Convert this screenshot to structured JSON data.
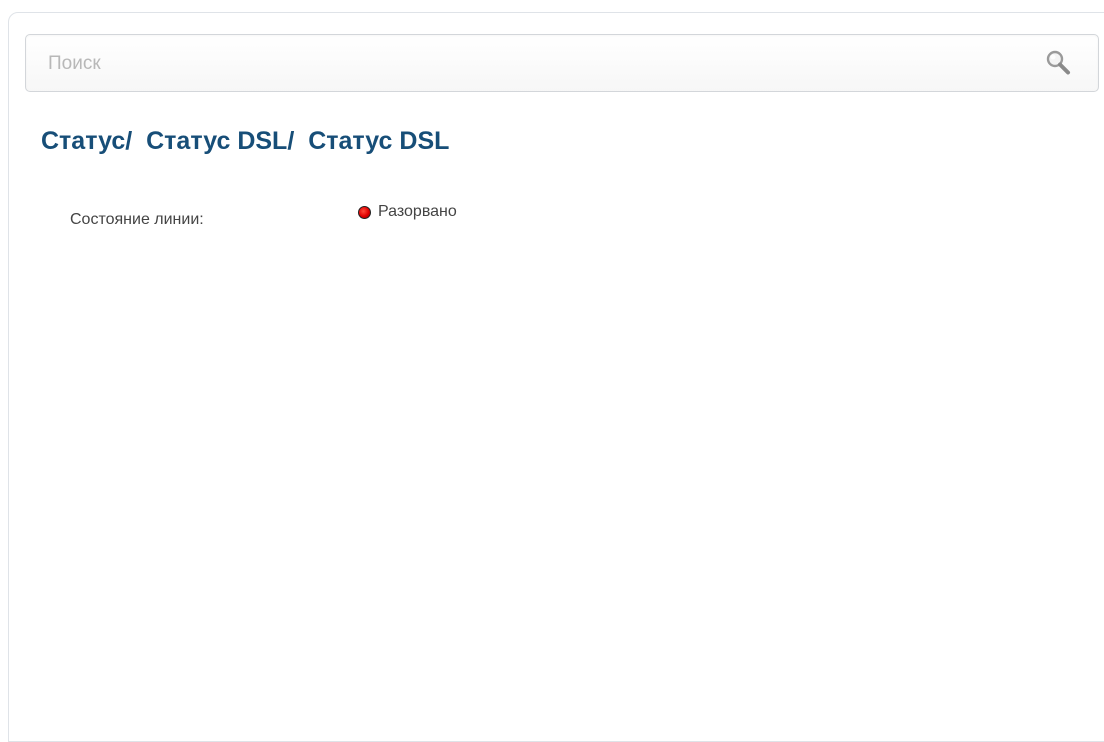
{
  "search": {
    "placeholder": "Поиск",
    "value": "",
    "icon": "search-icon"
  },
  "breadcrumb": {
    "items": [
      "Статус",
      "Статус DSL",
      "Статус DSL"
    ],
    "separator": "/",
    "color": "#174e78"
  },
  "dsl_status": {
    "line_state_label": "Состояние линии:",
    "line_state_value": "Разорвано",
    "indicator_icon": "red-status-dot-icon",
    "indicator_color": "#e00000"
  }
}
